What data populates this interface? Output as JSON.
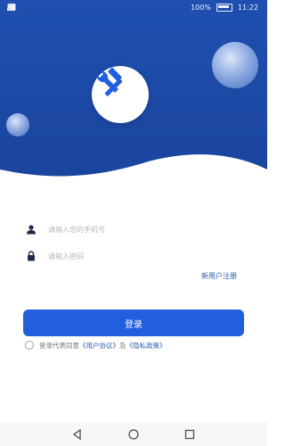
{
  "status_bar": {
    "battery_percent": "100%",
    "time": "11:22"
  },
  "colors": {
    "header_blue": "#1f4fb0",
    "header_blue_dark": "#1a459e",
    "button_blue": "#215fdc",
    "link_blue": "#2a5eb0",
    "placeholder_gray": "#b0b4bc"
  },
  "app": {
    "logo_icon": "tools-icon"
  },
  "login_form": {
    "phone_placeholder": "请输入您的手机号",
    "phone_icon": "user-icon",
    "password_placeholder": "请输入密码",
    "password_icon": "lock-icon",
    "register_link": "新用户注册",
    "login_button": "登录"
  },
  "agreement": {
    "prefix": "登录代表同意",
    "user_agreement": "《用户协议》",
    "and": "及",
    "privacy_policy": "《隐私政策》",
    "checked": false
  },
  "navigation_bar": {
    "back_icon": "triangle-back-icon",
    "home_icon": "circle-home-icon",
    "recent_icon": "square-recent-icon"
  }
}
